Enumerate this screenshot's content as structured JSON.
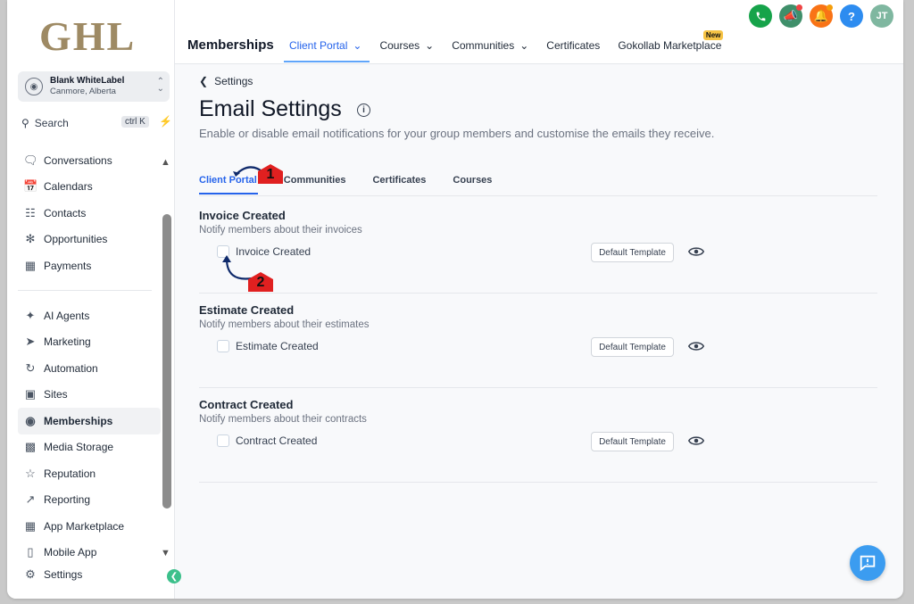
{
  "brand": {
    "logo_text": "GHL"
  },
  "account": {
    "name": "Blank WhiteLabel",
    "location": "Canmore, Alberta"
  },
  "search": {
    "label": "Search",
    "shortcut": "ctrl K"
  },
  "sidebar": {
    "group1": [
      {
        "label": "Conversations",
        "icon": "chat-bubble-icon"
      },
      {
        "label": "Calendars",
        "icon": "calendar-icon"
      },
      {
        "label": "Contacts",
        "icon": "contacts-icon"
      },
      {
        "label": "Opportunities",
        "icon": "opportunities-icon"
      },
      {
        "label": "Payments",
        "icon": "payments-icon"
      }
    ],
    "group2": [
      {
        "label": "AI Agents",
        "icon": "sparkle-icon"
      },
      {
        "label": "Marketing",
        "icon": "send-icon"
      },
      {
        "label": "Automation",
        "icon": "automation-icon"
      },
      {
        "label": "Sites",
        "icon": "sites-icon"
      },
      {
        "label": "Memberships",
        "icon": "badge-icon",
        "active": true
      },
      {
        "label": "Media Storage",
        "icon": "image-icon"
      },
      {
        "label": "Reputation",
        "icon": "star-icon"
      },
      {
        "label": "Reporting",
        "icon": "trend-icon"
      },
      {
        "label": "App Marketplace",
        "icon": "grid-icon"
      },
      {
        "label": "Mobile App",
        "icon": "phone-icon"
      }
    ],
    "settings": {
      "label": "Settings",
      "icon": "gear-icon"
    }
  },
  "topbar": {
    "title": "Memberships",
    "tabs": [
      {
        "label": "Client Portal",
        "dropdown": true,
        "active": true
      },
      {
        "label": "Courses",
        "dropdown": true
      },
      {
        "label": "Communities",
        "dropdown": true
      },
      {
        "label": "Certificates",
        "dropdown": false
      },
      {
        "label": "Gokollab Marketplace",
        "dropdown": false,
        "badge": "New"
      }
    ],
    "avatar_initials": "JT",
    "help_label": "?"
  },
  "page": {
    "back_label": "Settings",
    "title": "Email Settings",
    "info_label": "i",
    "description": "Enable or disable email notifications for your group members and customise the emails they receive.",
    "tabs": [
      "Client Portal",
      "Communities",
      "Certificates",
      "Courses"
    ]
  },
  "sections": [
    {
      "title": "Invoice Created",
      "description": "Notify members about their invoices",
      "checkbox_label": "Invoice Created",
      "button_label": "Default Template"
    },
    {
      "title": "Estimate Created",
      "description": "Notify members about their estimates",
      "checkbox_label": "Estimate Created",
      "button_label": "Default Template"
    },
    {
      "title": "Contract Created",
      "description": "Notify members about their contracts",
      "checkbox_label": "Contract Created",
      "button_label": "Default Template"
    }
  ],
  "annotations": {
    "marker1": "1",
    "marker2": "2"
  },
  "colors": {
    "accent": "#2563eb",
    "marker": "#e02020",
    "call": "#16a34a",
    "announce": "#3f8f6a",
    "bell": "#f97316",
    "help": "#2d8cf0",
    "avatar": "#7fb7a0"
  }
}
